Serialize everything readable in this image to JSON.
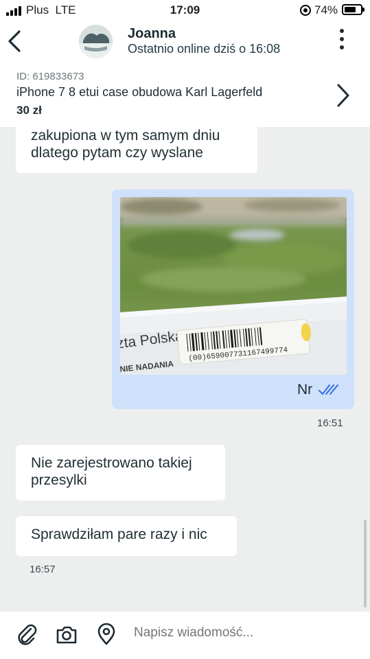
{
  "status_bar": {
    "carrier": "Plus",
    "network": "LTE",
    "time": "17:09",
    "battery_percent": "74%",
    "battery_level": 0.74
  },
  "header": {
    "contact_name": "Joanna",
    "online_status": "Ostatnio online dziś o 16:08",
    "icons": [
      "back-arrow-icon",
      "avatar",
      "more-vertical-icon"
    ]
  },
  "product": {
    "id_label": "ID: 619833673",
    "title": "iPhone 7 8 etui case obudowa Karl Lagerfeld",
    "price": "30 zł"
  },
  "messages": [
    {
      "direction": "incoming",
      "text_line1": "zakupiona w tym samym dniu",
      "text_line2": "dlatego pytam czy wyslane"
    },
    {
      "direction": "outgoing",
      "photo": {
        "label_text": "zta Polska",
        "label_subtext": "NIE NADANIA",
        "barcode_number": "(00)659007731167499774"
      },
      "caption": "Nr",
      "read_receipt_icon": "double-check-icon",
      "time": "16:51"
    },
    {
      "direction": "incoming",
      "text_line1": "Nie zarejestrowano takiej",
      "text_line2": "przesylki"
    },
    {
      "direction": "incoming",
      "text": "Sprawdziłam pare razy i nic",
      "time": "16:57"
    }
  ],
  "composer": {
    "placeholder": "Napisz wiadomość...",
    "icons": [
      "paperclip-icon",
      "camera-icon",
      "location-pin-icon"
    ]
  },
  "colors": {
    "outgoing_bubble": "#cfe0fb",
    "incoming_bubble": "#ffffff",
    "chat_background": "#edeeee",
    "read_receipt": "#2f6fe0"
  }
}
